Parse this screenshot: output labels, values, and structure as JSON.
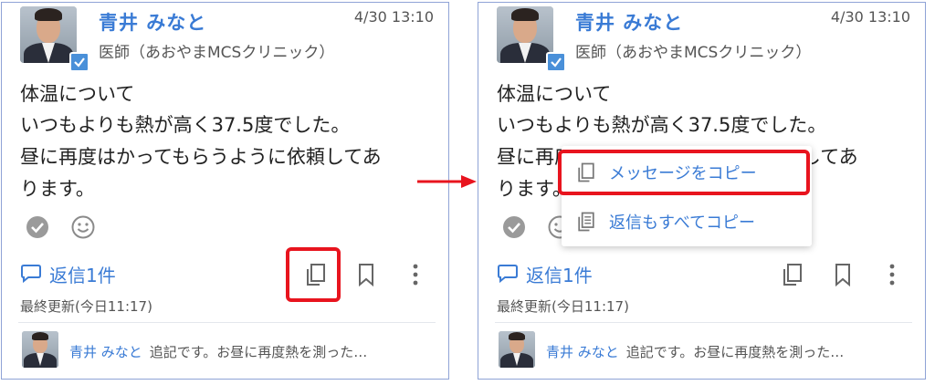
{
  "post": {
    "author_name": "青井 みなと",
    "author_role": "医師（あおやまMCSクリニック）",
    "timestamp": "4/30 13:10",
    "body": [
      "体温について",
      "いつもよりも熱が高く37.5度でした。",
      "昼に再度はかってもらうように依頼してあ",
      "ります。"
    ],
    "reply_label": "返信1件",
    "updated_label": "最終更新(今日11:17)",
    "latest_reply": {
      "name": "青井 みなと",
      "text": "追記です。お昼に再度熱を測った…"
    }
  },
  "context_menu": {
    "copy_message": "メッセージをコピー",
    "copy_with_replies": "返信もすべてコピー"
  },
  "colors": {
    "accent": "#3a7bd5",
    "highlight": "#e8141e",
    "panel_border": "#8fa3d6"
  }
}
